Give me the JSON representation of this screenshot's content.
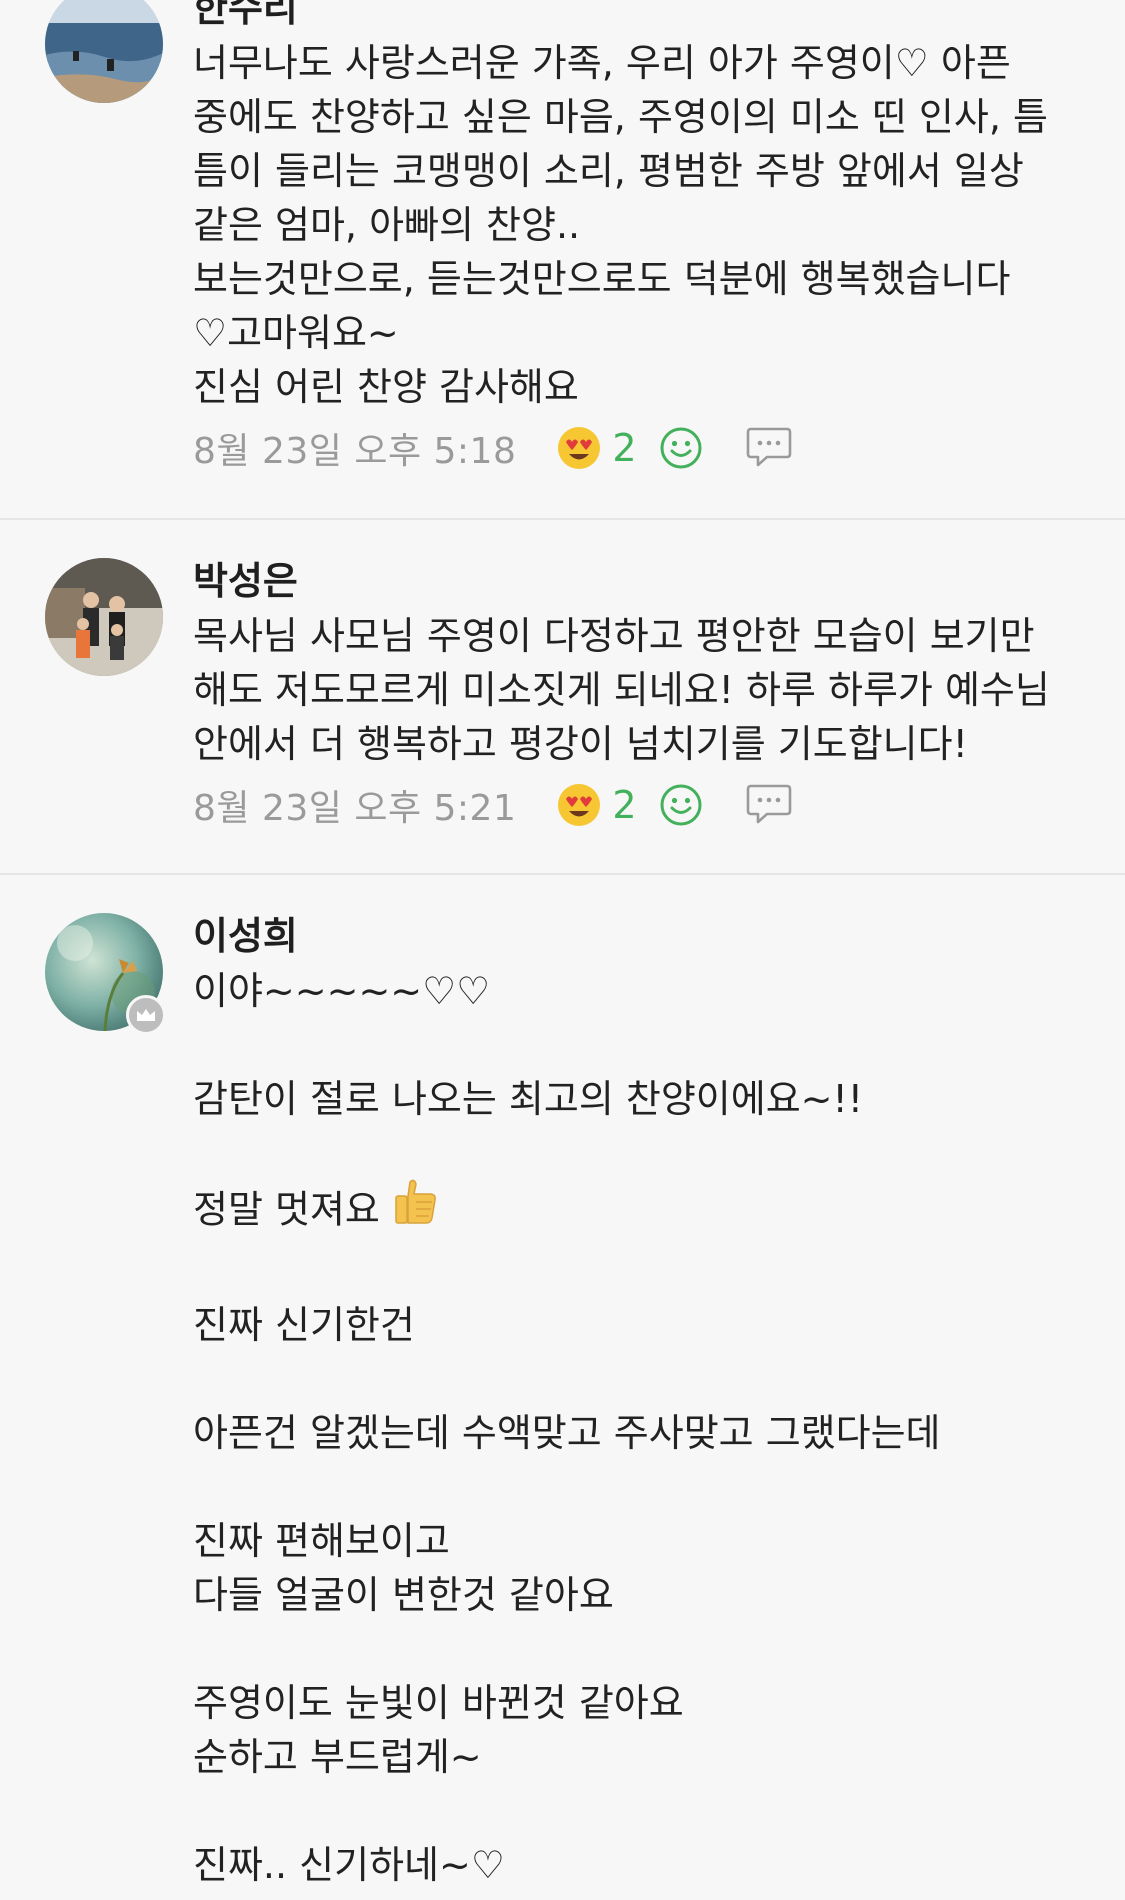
{
  "comments": [
    {
      "author": "한수리",
      "text": "너무나도 사랑스러운 가족, 우리 아가 주영이♡ 아픈\n중에도 찬양하고 싶은 마음, 주영이의 미소 띤 인사, 틈\n틈이 들리는 코맹맹이 소리, 평범한 주방 앞에서 일상\n같은 엄마, 아빠의 찬양..\n보는것만으로, 듣는것만으로도 덕분에 행복했습니다\n♡고마워요~\n진심 어린 찬양 감사해요",
      "date": "8월 23일 오후 5:18",
      "reaction_count": "2"
    },
    {
      "author": "박성은",
      "text": "목사님 사모님 주영이 다정하고 평안한 모습이 보기만\n해도 저도모르게 미소짓게 되네요! 하루 하루가 예수님\n안에서 더 행복하고 평강이 넘치기를 기도합니다!",
      "date": "8월 23일 오후 5:21",
      "reaction_count": "2"
    },
    {
      "author": "이성희",
      "text_before_emoji": "이야~~~~~♡♡\n\n감탄이 절로 나오는 최고의 찬양이에요~!!\n\n정말 멋져요",
      "text_after_emoji": "\n\n진짜 신기한건\n\n아픈건 알겠는데 수액맞고 주사맞고 그랬다는데\n\n진짜 편해보이고\n다들 얼굴이 변한것 같아요\n\n주영이도 눈빛이 바뀐것 같아요\n순하고 부드럽게~\n\n진짜.. 신기하네~♡"
    }
  ],
  "icons": {
    "reaction": "heart-eyes-emoji-icon",
    "add_reaction": "smiley-icon",
    "reply": "speech-bubble-icon",
    "badge": "crown-icon",
    "emoji_in_text": "thumbs-up-emoji-icon"
  },
  "colors": {
    "accent_green": "#43b05c",
    "meta_gray": "#9a9a9a",
    "divider": "#e6e6e6",
    "background": "#f7f7f7"
  }
}
